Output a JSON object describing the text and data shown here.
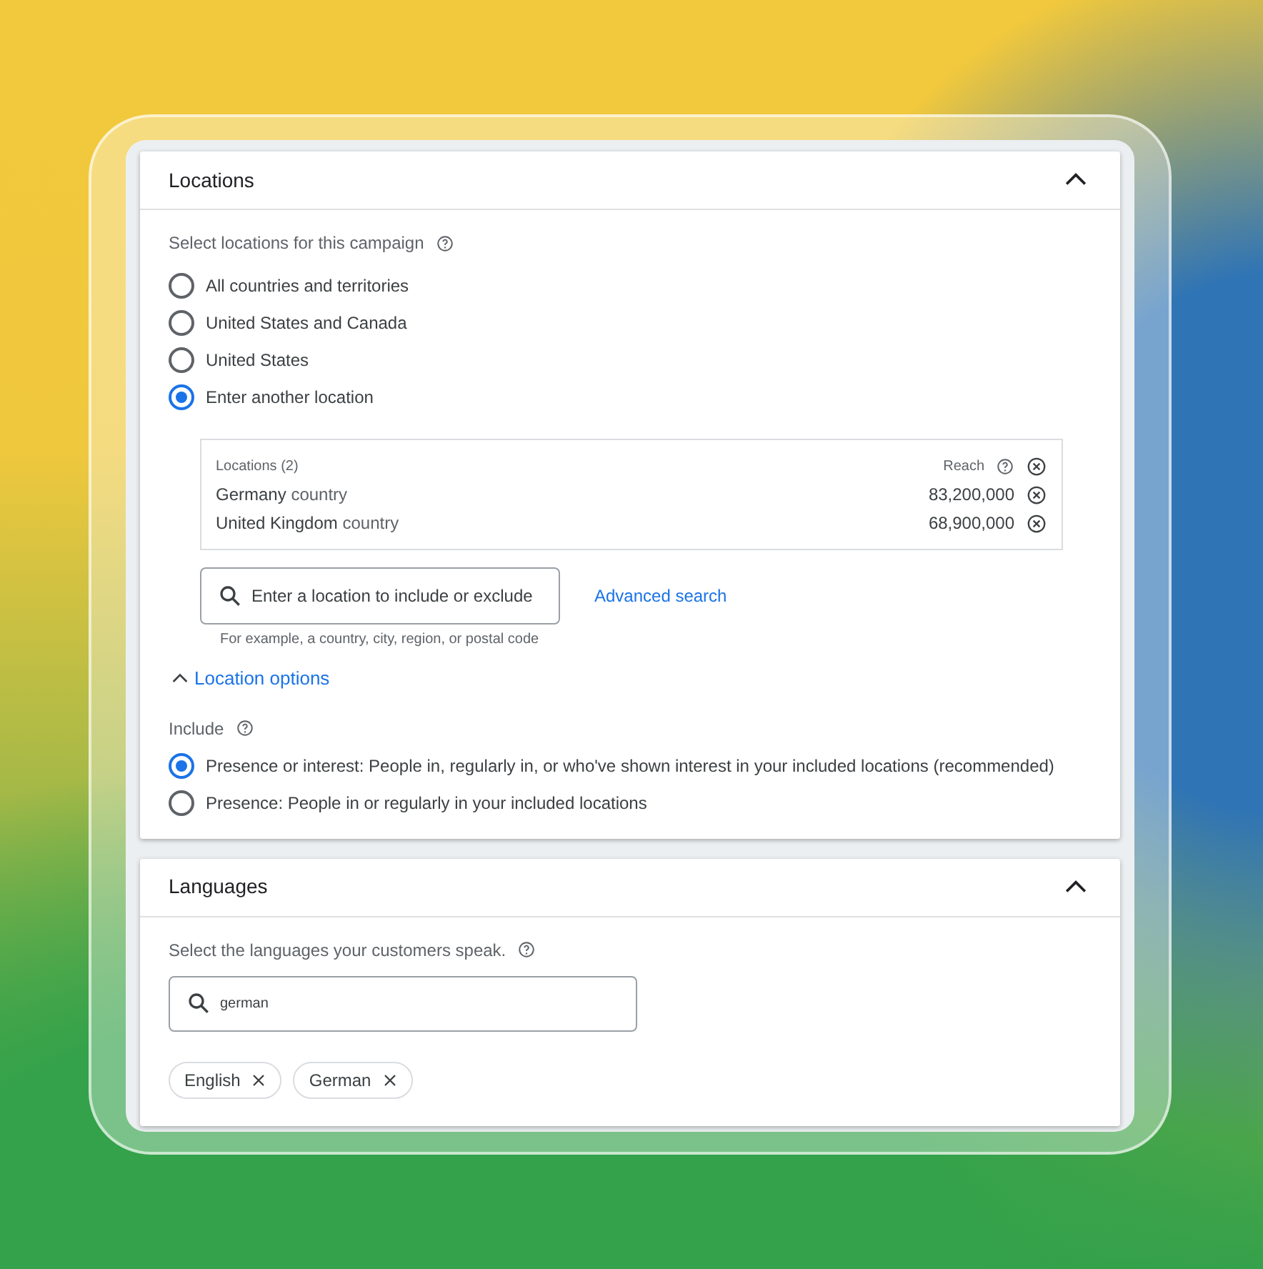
{
  "locations_section": {
    "title": "Locations",
    "expanded": true,
    "prompt": "Select locations for this campaign",
    "options": [
      {
        "label": "All countries and territories",
        "selected": false
      },
      {
        "label": "United States and Canada",
        "selected": false
      },
      {
        "label": "United States",
        "selected": false
      },
      {
        "label": "Enter another location",
        "selected": true
      }
    ],
    "table": {
      "heading": "Locations (2)",
      "reach_label": "Reach",
      "rows": [
        {
          "name": "Germany",
          "type": "country",
          "reach": "83,200,000"
        },
        {
          "name": "United Kingdom",
          "type": "country",
          "reach": "68,900,000"
        }
      ]
    },
    "search": {
      "placeholder": "Enter a location to include or exclude",
      "hint": "For example, a country, city, region, or postal code"
    },
    "advanced_link": "Advanced search",
    "location_options": {
      "label": "Location options",
      "expanded": true,
      "include_label": "Include",
      "choices": [
        {
          "label": "Presence or interest: People in, regularly in, or who've shown interest in your included locations (recommended)",
          "selected": true
        },
        {
          "label": "Presence: People in or regularly in your included locations",
          "selected": false
        }
      ]
    }
  },
  "languages_section": {
    "title": "Languages",
    "expanded": true,
    "prompt": "Select the languages your customers speak.",
    "search": {
      "value": "german"
    },
    "chips": [
      "English",
      "German"
    ]
  }
}
